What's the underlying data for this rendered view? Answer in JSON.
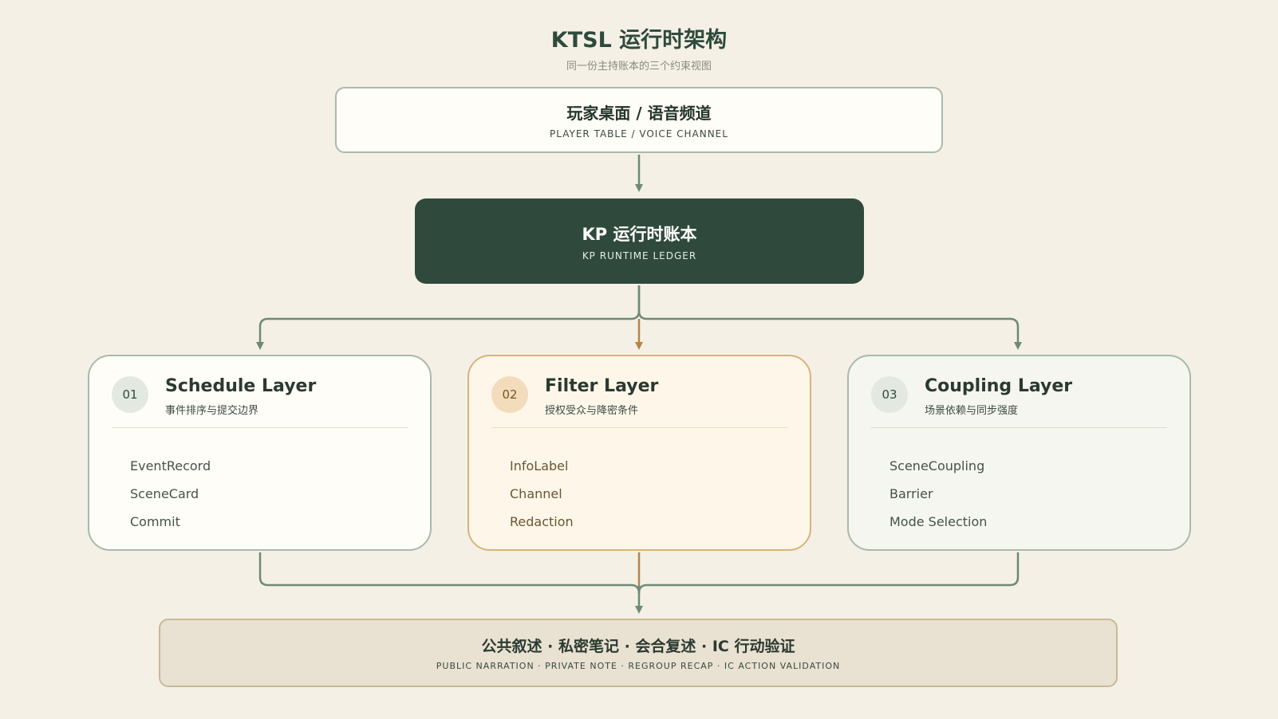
{
  "header": {
    "title": "KTSL 运行时架构",
    "subtitle": "同一份主持账本的三个约束视图"
  },
  "nodes": {
    "player": {
      "zh": "玩家桌面 / 语音频道",
      "en": "PLAYER TABLE / VOICE CHANNEL"
    },
    "ledger": {
      "zh": "KP 运行时账本",
      "en": "KP RUNTIME LEDGER"
    },
    "output": {
      "zh": "公共叙述 · 私密笔记 · 会合复述 · IC 行动验证",
      "en": "PUBLIC NARRATION · PRIVATE NOTE · REGROUP RECAP · IC ACTION VALIDATION"
    }
  },
  "layers": [
    {
      "num": "01",
      "name": "Schedule Layer",
      "desc": "事件排序与提交边界",
      "items": [
        "EventRecord",
        "SceneCard",
        "Commit"
      ]
    },
    {
      "num": "02",
      "name": "Filter Layer",
      "desc": "授权受众与降密条件",
      "items": [
        "InfoLabel",
        "Channel",
        "Redaction"
      ]
    },
    {
      "num": "03",
      "name": "Coupling Layer",
      "desc": "场景依赖与同步强度",
      "items": [
        "SceneCoupling",
        "Barrier",
        "Mode Selection"
      ]
    }
  ],
  "colors": {
    "background": "#f4f0e6",
    "green_dark": "#2f4a3c",
    "connector_green": "#6e8a77",
    "connector_orange": "#b9834a",
    "filter_border": "#d9b27d",
    "output_fill": "#e9e1d2"
  }
}
